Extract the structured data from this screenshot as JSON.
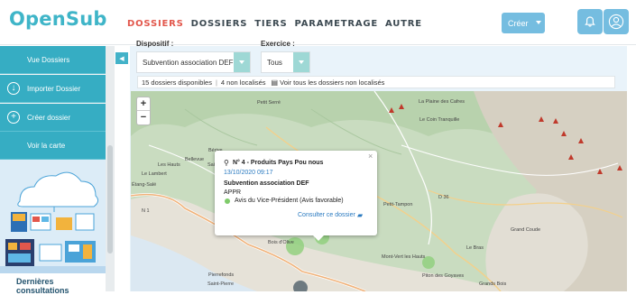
{
  "app": {
    "logo": "OpenSub"
  },
  "nav": {
    "items": [
      {
        "label": "DOSSIERS",
        "active": true
      },
      {
        "label": "DOSSIERS",
        "active": false
      },
      {
        "label": "TIERS",
        "active": false
      },
      {
        "label": "PARAMETRAGE",
        "active": false
      },
      {
        "label": "AUTRE",
        "active": false
      }
    ]
  },
  "header": {
    "create_label": "Créer"
  },
  "sidebar": {
    "items": [
      {
        "label": "Vue Dossiers",
        "icon": "none"
      },
      {
        "label": "Importer Dossier",
        "icon": "download-icon"
      },
      {
        "label": "Créer dossier",
        "icon": "plus-icon"
      },
      {
        "label": "Voir la carte",
        "icon": "none"
      }
    ],
    "recent_title": "Dernières consultations"
  },
  "filters": {
    "dispositif": {
      "label": "Dispositif :",
      "value": "Subvention association DEF"
    },
    "exercice": {
      "label": "Exercice :",
      "value": "Tous"
    }
  },
  "infobar": {
    "available": "15 dossiers disponibles",
    "non_located": "4 non localisés",
    "link": "Voir tous les dossiers non localisés"
  },
  "map": {
    "zoom_in": "+",
    "zoom_out": "−",
    "places": [
      "Petit Serré",
      "La Plaine des Cafres",
      "Le Coin Tranquille",
      "Bérive",
      "Saint-Leu",
      "Le Lambert",
      "Étang-Salé",
      "Les Hauts",
      "Petit-Tampon",
      "D 36",
      "Grand Coude",
      "Le Bras",
      "Bois d'Olive",
      "Mont-Vert les Hauts",
      "Pierrefonds",
      "Piton des Goyaves",
      "Saint-Pierre",
      "Grands Bois",
      "Bellevue",
      "N 1"
    ]
  },
  "popup": {
    "title": "N° 4 - Produits Pays Pou nous",
    "date": "13/10/2020 09:17",
    "dispositif": "Subvention association DEF",
    "status": "APPR",
    "avis": "Avis du Vice-Président (Avis favorable)",
    "link": "Consulter ce dossier",
    "close": "×"
  },
  "colors": {
    "accent": "#36adc3",
    "active_nav": "#e2574c",
    "button": "#75bde0",
    "marker": "#7fcb6a"
  }
}
